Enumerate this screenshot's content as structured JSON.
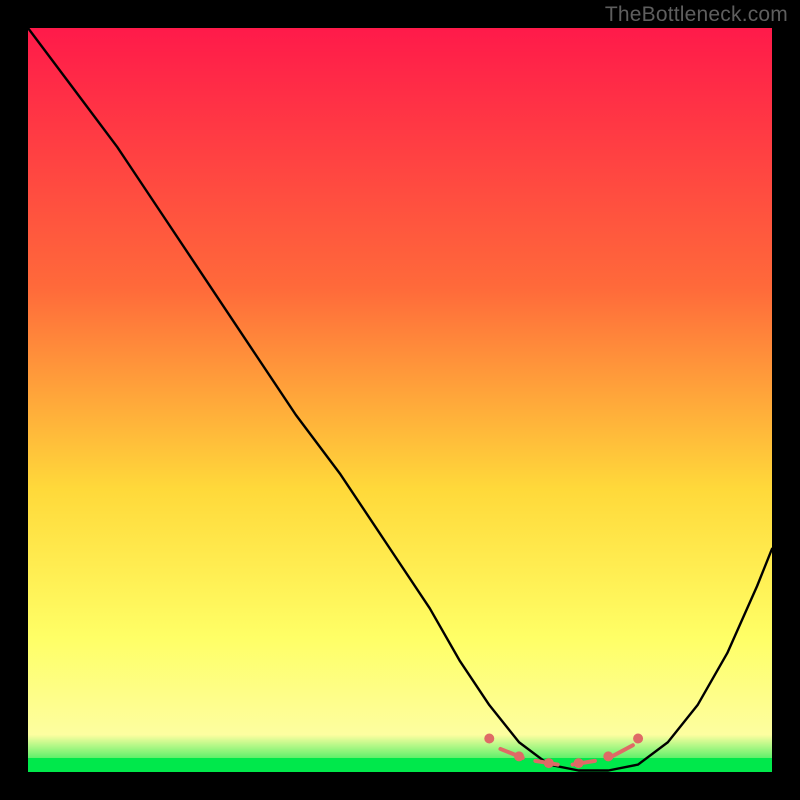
{
  "watermark": "TheBottleneck.com",
  "chart_data": {
    "type": "line",
    "title": "",
    "xlabel": "",
    "ylabel": "",
    "xlim": [
      0,
      100
    ],
    "ylim": [
      0,
      100
    ],
    "gradient_colors": {
      "top": "#ff1a4a",
      "mid_upper": "#ff6a3a",
      "mid": "#ffd93a",
      "mid_lower": "#ffff66",
      "bottom_band": "#fdfea0",
      "green": "#00e84b"
    },
    "curve": {
      "x": [
        0,
        6,
        12,
        18,
        24,
        30,
        36,
        42,
        48,
        54,
        58,
        62,
        66,
        70,
        74,
        78,
        82,
        86,
        90,
        94,
        98,
        100
      ],
      "y": [
        100,
        92,
        84,
        75,
        66,
        57,
        48,
        40,
        31,
        22,
        15,
        9,
        4,
        1,
        0.2,
        0.2,
        1,
        4,
        9,
        16,
        25,
        30
      ]
    },
    "markers": {
      "x": [
        62,
        66,
        70,
        74,
        78,
        82
      ],
      "y": [
        4.5,
        2.1,
        1.2,
        1.2,
        2.1,
        4.5
      ],
      "color": "#df6a66",
      "radius": 5
    },
    "dashes": {
      "color": "#df6a66",
      "width": 4,
      "segments": [
        {
          "x0": 63.5,
          "y0": 3.1,
          "x1": 66.5,
          "y1": 1.9
        },
        {
          "x0": 68.2,
          "y0": 1.5,
          "x1": 71.2,
          "y1": 1.0
        },
        {
          "x0": 73.2,
          "y0": 1.0,
          "x1": 76.2,
          "y1": 1.5
        },
        {
          "x0": 78.5,
          "y0": 2.1,
          "x1": 81.3,
          "y1": 3.6
        }
      ]
    }
  }
}
